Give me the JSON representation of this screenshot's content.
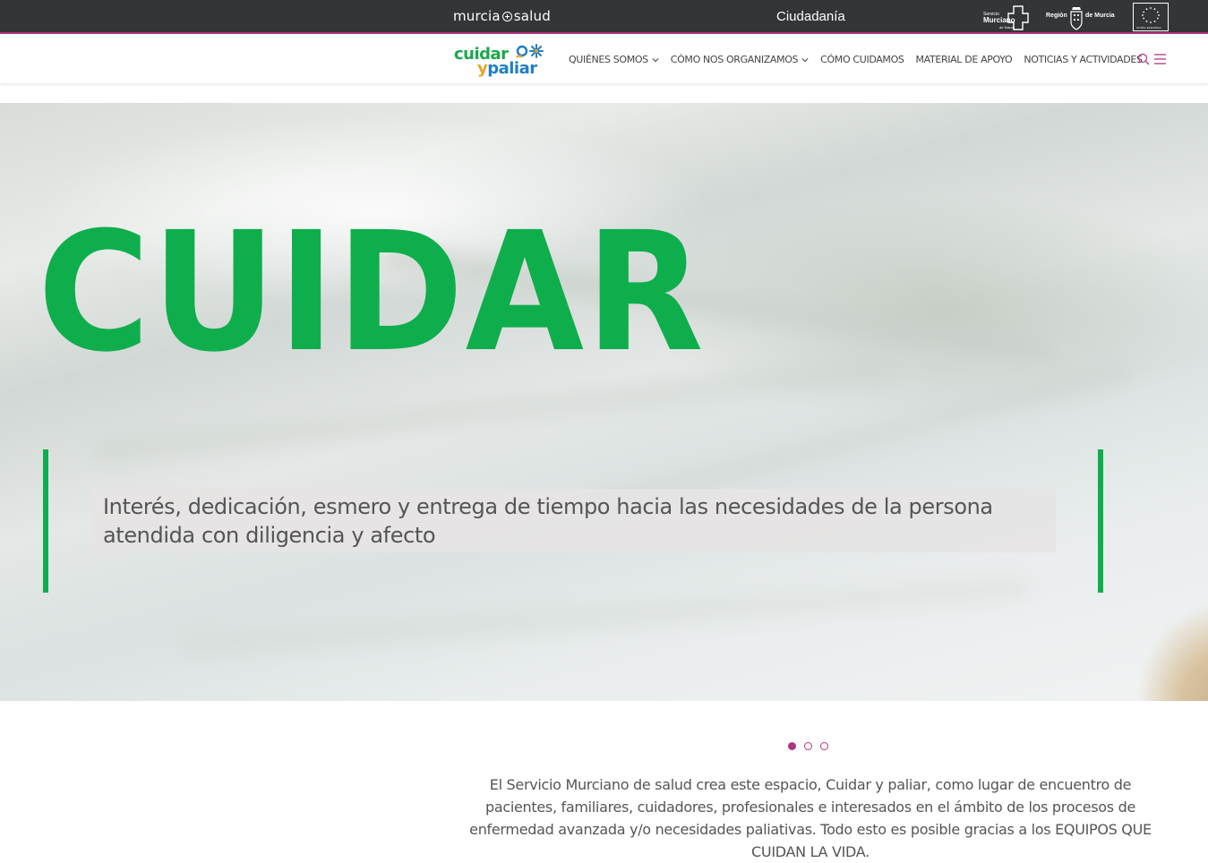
{
  "topbar": {
    "brand": {
      "left": "murcia",
      "right": "salud"
    },
    "section": "Ciudadanía",
    "logo_sms": {
      "line1": "Servicio",
      "line2": "Murciano",
      "line3": "de Salud"
    },
    "logo_region": {
      "left": "Región",
      "right": "de Murcia"
    },
    "logo_eu": {
      "caption": "UNIÓN EUROPEA"
    }
  },
  "navbar": {
    "logo": {
      "line1": "cuidar",
      "line2_y": "y",
      "line2_rest": "paliar"
    },
    "items": [
      {
        "label": "QUIÉNES SOMOS",
        "has_dropdown": true
      },
      {
        "label": "CÓMO NOS ORGANIZAMOS",
        "has_dropdown": true
      },
      {
        "label": "CÓMO CUIDAMOS",
        "has_dropdown": false
      },
      {
        "label": "MATERIAL DE APOYO",
        "has_dropdown": false
      },
      {
        "label": "NOTICIAS Y ACTIVIDADES",
        "has_dropdown": false
      }
    ],
    "icons": [
      "search-icon",
      "menu-icon"
    ]
  },
  "hero": {
    "title": "CUIDAR",
    "quote": "Interés, dedicación, esmero y entrega de tiempo hacia las necesidades de la persona atendida con diligencia y afecto"
  },
  "carousel": {
    "slides": 3,
    "active": 0
  },
  "intro": {
    "text": "El Servicio Murciano de salud crea este espacio, Cuidar y paliar, como lugar de encuentro de pacientes, familiares, cuidadores, profesionales e interesados en el ámbito de los procesos de enfermedad avanzada y/o necesidades paliativas. Todo esto es posible gracias a los EQUIPOS QUE CUIDAN LA VIDA."
  },
  "colors": {
    "topbar_bg": "#333539",
    "accent_magenta": "#b1357f",
    "green": "#0fae4c",
    "logo_blue": "#1f7fc4",
    "logo_yellow": "#e9a31f"
  }
}
